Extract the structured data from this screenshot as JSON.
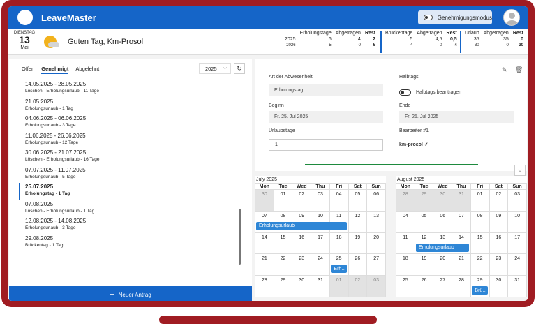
{
  "app": {
    "title": "LeaveMaster",
    "approval_mode_label": "Genehmigungsmodus"
  },
  "header": {
    "weekday": "DIENSTAG",
    "day": "13",
    "month": "Mai",
    "greeting": "Guten Tag, Km-Prosol"
  },
  "stats": [
    {
      "title": "Erholungstage",
      "rows": [
        [
          "2025",
          "6",
          "4",
          "2"
        ],
        [
          "2026",
          "5",
          "0",
          "5"
        ]
      ]
    },
    {
      "title": "Brückentage",
      "rows": [
        [
          "",
          "5",
          "4,5",
          "0,5"
        ],
        [
          "",
          "4",
          "0",
          "4"
        ]
      ]
    },
    {
      "title": "Urlaub",
      "rows": [
        [
          "",
          "35",
          "35",
          "0"
        ],
        [
          "",
          "30",
          "0",
          "30"
        ]
      ]
    }
  ],
  "stats_cols": {
    "taken": "Abgetragen",
    "rest": "Rest"
  },
  "tabs": [
    "Offen",
    "Genehmigt",
    "Abgelehnt"
  ],
  "year": "2025",
  "leave_list": [
    {
      "dates": "14.05.2025 - 28.05.2025",
      "type": "Löschen - Erholungsurlaub - 11 Tage"
    },
    {
      "dates": "21.05.2025",
      "type": "Erholungsurlaub - 1 Tag"
    },
    {
      "dates": "04.06.2025 - 06.06.2025",
      "type": "Erholungsurlaub - 3 Tage"
    },
    {
      "dates": "11.06.2025 - 26.06.2025",
      "type": "Erholungsurlaub - 12 Tage"
    },
    {
      "dates": "30.06.2025 - 21.07.2025",
      "type": "Löschen - Erholungsurlaub - 16 Tage"
    },
    {
      "dates": "07.07.2025 - 11.07.2025",
      "type": "Erholungsurlaub - 5 Tage"
    },
    {
      "dates": "25.07.2025",
      "type": "Erholungstag - 1 Tag"
    },
    {
      "dates": "07.08.2025",
      "type": "Löschen - Erholungsurlaub - 1 Tag"
    },
    {
      "dates": "12.08.2025 - 14.08.2025",
      "type": "Erholungsurlaub - 3 Tage"
    },
    {
      "dates": "29.08.2025",
      "type": "Brückentag - 1 Tag"
    }
  ],
  "new_request_label": "Neuer Antrag",
  "detail": {
    "type_label": "Art der Abwesenheit",
    "type_value": "Erholungstag",
    "halfday_label": "Halbtags",
    "halfday_toggle_label": "Halbtags beantragen",
    "start_label": "Beginn",
    "start_value": "Fr. 25. Jul 2025",
    "end_label": "Ende",
    "end_value": "Fr. 25. Jul 2025",
    "days_label": "Urlaubstage",
    "days_value": "1",
    "approver_label": "Bearbeiter #1",
    "approver_value": "km-prosol ✓"
  },
  "weekdays": [
    "Mon",
    "Tue",
    "Wed",
    "Thu",
    "Fri",
    "Sat",
    "Sun"
  ],
  "calendars": [
    {
      "title": "July 2025",
      "weeks": [
        [
          "30",
          "01",
          "02",
          "03",
          "04",
          "05",
          "06"
        ],
        [
          "07",
          "08",
          "09",
          "10",
          "11",
          "12",
          "13"
        ],
        [
          "14",
          "15",
          "16",
          "17",
          "18",
          "19",
          "20"
        ],
        [
          "21",
          "22",
          "23",
          "24",
          "25",
          "26",
          "27"
        ],
        [
          "28",
          "29",
          "30",
          "31",
          "01",
          "02",
          "03"
        ]
      ],
      "events": [
        {
          "label": "Erholungsurlaub",
          "week": 1,
          "start": 0,
          "span": 5
        },
        {
          "label": "Erh...",
          "week": 3,
          "start": 4,
          "span": 1
        }
      ]
    },
    {
      "title": "August 2025",
      "weeks": [
        [
          "28",
          "29",
          "30",
          "31",
          "01",
          "02",
          "03"
        ],
        [
          "04",
          "05",
          "06",
          "07",
          "08",
          "09",
          "10"
        ],
        [
          "11",
          "12",
          "13",
          "14",
          "15",
          "16",
          "17"
        ],
        [
          "18",
          "19",
          "20",
          "21",
          "22",
          "23",
          "24"
        ],
        [
          "25",
          "26",
          "27",
          "28",
          "29",
          "30",
          "31"
        ]
      ],
      "events": [
        {
          "label": "Erholungsurlaub",
          "week": 2,
          "start": 1,
          "span": 3
        },
        {
          "label": "Brü...",
          "week": 4,
          "start": 4,
          "span": 1
        }
      ]
    }
  ]
}
